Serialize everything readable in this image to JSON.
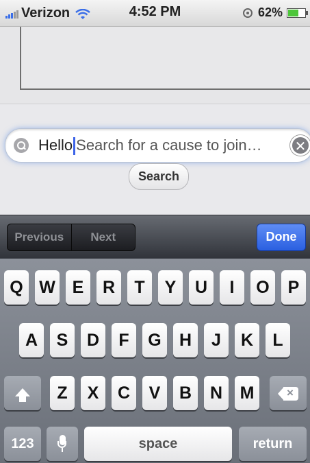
{
  "status_bar": {
    "carrier": "Verizon",
    "time": "4:52 PM",
    "battery_text": "62%",
    "battery_level": 0.62,
    "icons": [
      "signal-bars-icon",
      "wifi-icon",
      "orientation-lock-icon",
      "battery-icon"
    ]
  },
  "search": {
    "typed_text": "Hello",
    "placeholder": "Search for a cause to join…",
    "button_label": "Search",
    "icons": [
      "search-icon",
      "clear-icon"
    ]
  },
  "accessory_bar": {
    "previous_label": "Previous",
    "next_label": "Next",
    "done_label": "Done"
  },
  "keyboard": {
    "row1": [
      "Q",
      "W",
      "E",
      "R",
      "T",
      "Y",
      "U",
      "I",
      "O",
      "P"
    ],
    "row2": [
      "A",
      "S",
      "D",
      "F",
      "G",
      "H",
      "J",
      "K",
      "L"
    ],
    "row3": [
      "Z",
      "X",
      "C",
      "V",
      "B",
      "N",
      "M"
    ],
    "numbers_label": "123",
    "space_label": "space",
    "return_label": "return",
    "icons": [
      "shift-icon",
      "backspace-icon",
      "microphone-icon"
    ]
  },
  "colors": {
    "accent": "#3c63e8",
    "done_button": "#2a5fe0",
    "battery": "#4dc63a"
  }
}
